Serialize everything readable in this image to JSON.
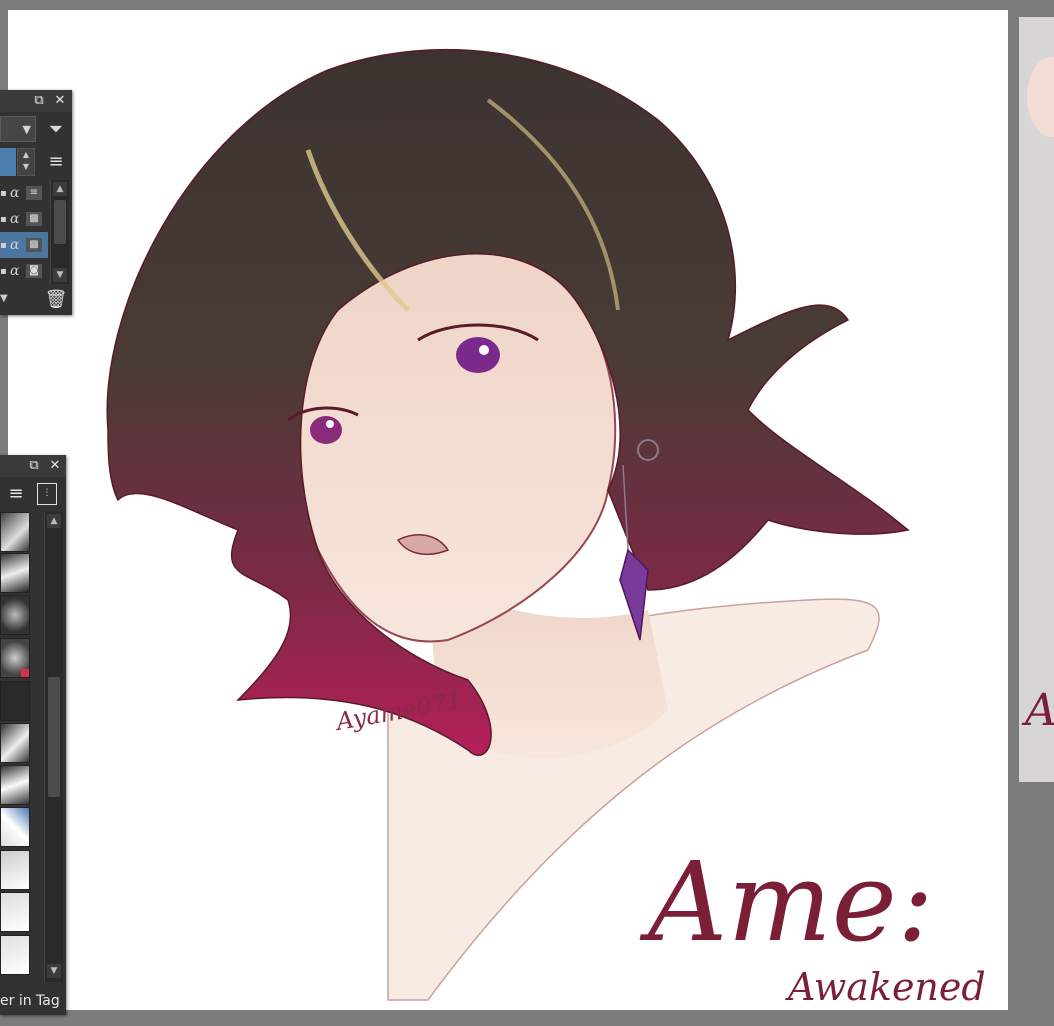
{
  "app": {
    "canvas_background": "#ffffff",
    "workspace_background": "#7c7c7c",
    "artwork": {
      "subject": "digital painting of a character with dark hair fading to magenta tips",
      "signature_text": "Ayame071",
      "title_script": "Ame:",
      "subtitle_script": "Awakened"
    }
  },
  "layers_docker": {
    "float_icon": "float-icon",
    "close_icon": "close-icon",
    "filter_icon": "filter-icon",
    "menu_icon": "hamburger-menu-icon",
    "layers": [
      {
        "lock": "🔒",
        "alpha": "α",
        "badge": "▦",
        "selected": false
      },
      {
        "lock": "🔒",
        "alpha": "α",
        "badge": "▩",
        "selected": false
      },
      {
        "lock": "🔒",
        "alpha": "α",
        "badge": "▩",
        "selected": true
      },
      {
        "lock": "🔒",
        "alpha": "α",
        "badge": "◙",
        "selected": false
      }
    ],
    "delete_icon": "trash-icon"
  },
  "brush_docker": {
    "float_icon": "float-icon",
    "close_icon": "close-icon",
    "view_menu_icon": "hamburger-menu-icon",
    "footer_text": "er in Tag"
  },
  "reference_panel": {
    "visible_text": "A"
  }
}
